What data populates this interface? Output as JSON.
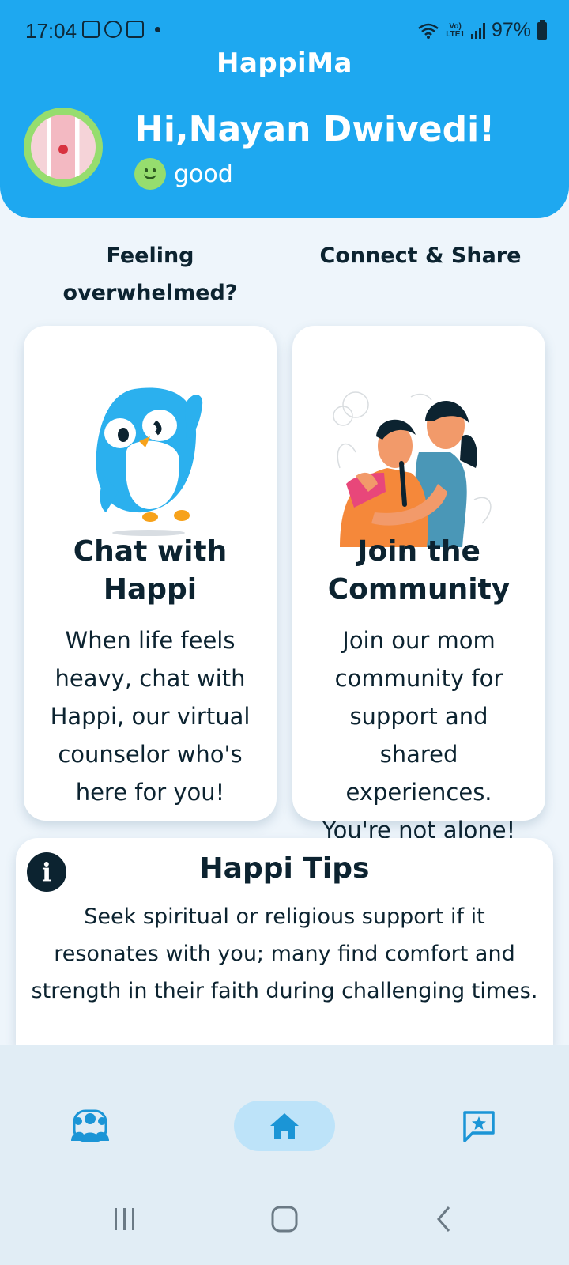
{
  "status_bar": {
    "time": "17:04",
    "battery": "97%",
    "network": "LTE1"
  },
  "header": {
    "app_title": "HappiMa",
    "greeting": "Hi,Nayan Dwivedi!",
    "mood": "good"
  },
  "sections": [
    {
      "heading": "Feeling overwhelmed?",
      "card_title": "Chat with Happi",
      "card_description": "When life feels heavy, chat with Happi, our virtual counselor who's here for you!",
      "illustration": "penguin-mascot"
    },
    {
      "heading": "Connect & Share",
      "card_title": "Join the Community",
      "card_description": "Join our mom community for support and shared experiences. You're not alone!",
      "illustration": "two-women-hugging"
    }
  ],
  "tips": {
    "title": "Happi Tips",
    "text": "Seek spiritual or religious support if it resonates with you; many find comfort and strength in their faith during challenging times."
  },
  "bottom_nav": {
    "items": [
      {
        "icon": "community-icon",
        "active": false
      },
      {
        "icon": "home-icon",
        "active": true
      },
      {
        "icon": "chat-star-icon",
        "active": false
      }
    ]
  },
  "colors": {
    "header_blue": "#1ea8f0",
    "accent_green": "#96dd6e",
    "text_dark": "#0c2330",
    "nav_active": "#bde3f9",
    "icon_blue": "#1b95d6"
  }
}
